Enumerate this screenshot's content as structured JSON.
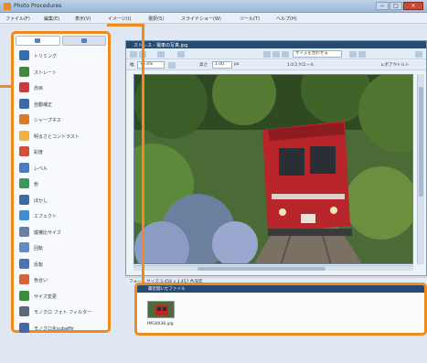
{
  "app": {
    "title": "Photo Procedures",
    "window_controls": [
      "−",
      "□",
      "×"
    ]
  },
  "menubar": {
    "items": [
      "ファイル(F)",
      "編集(E)",
      "表示(V)",
      "イメージ(I)",
      "選択(S)",
      "スライドショー(W)",
      "ツール(T)",
      "ヘルプ(H)"
    ]
  },
  "palette": {
    "tools": [
      {
        "label": "トリミング",
        "icon": "crop-icon",
        "color": "#2f6fb7"
      },
      {
        "label": "ストレート",
        "icon": "straighten-icon",
        "color": "#3c8c3c"
      },
      {
        "label": "赤目",
        "icon": "red-eye-icon",
        "color": "#c83c3c"
      },
      {
        "label": "自動補正",
        "icon": "auto-fix-icon",
        "color": "#3a6aa8"
      },
      {
        "label": "シャープネス",
        "icon": "sharpen-icon",
        "color": "#e07a1e"
      },
      {
        "label": "明るさとコントラスト",
        "icon": "brightness-icon",
        "color": "#f0b23a"
      },
      {
        "label": "彩度",
        "icon": "saturation-icon",
        "color": "#d04f3a"
      },
      {
        "label": "レベル",
        "icon": "levels-icon",
        "color": "#4a7bbf"
      },
      {
        "label": "色",
        "icon": "color-icon",
        "color": "#3a9a5a"
      },
      {
        "label": "ぼかし",
        "icon": "blur-icon",
        "color": "#3a6aa8"
      },
      {
        "label": "エフェクト",
        "icon": "effect-icon",
        "color": "#3f8fd0"
      },
      {
        "label": "縦横比サイズ",
        "icon": "resize-icon",
        "color": "#6a7fa0"
      },
      {
        "label": "回転",
        "icon": "rotate-icon",
        "color": "#5b8fc4"
      },
      {
        "label": "反転",
        "icon": "flip-icon",
        "color": "#4a74b3"
      },
      {
        "label": "色合い",
        "icon": "tint-icon",
        "color": "#d9623a"
      },
      {
        "label": "サイズ変更",
        "icon": "size-icon",
        "color": "#3c8c3c"
      },
      {
        "label": "モノクロ フォト フィルター",
        "icon": "mono-filter-icon",
        "color": "#5a6a7a"
      },
      {
        "label": "モノクロ化subaffir",
        "icon": "mono-convert-icon",
        "color": "#4466aa"
      }
    ]
  },
  "image_window": {
    "title": "ストレス - 電車の写真.jpg",
    "zoom": "76.4%",
    "coord_field": "サイズを合わせる",
    "position_field": "1.00",
    "toolbar_text": "1.0スクロール",
    "label_width": "幅",
    "label_height": "高さ",
    "unit": "px",
    "right_label": "レポアウトルト"
  },
  "statusbar": {
    "text": "フォーム  サイズ:3,456 x 3,457  色深度"
  },
  "browser": {
    "title": "最近開いたファイル",
    "thumbnail_label": "IMG0038.jpg"
  }
}
